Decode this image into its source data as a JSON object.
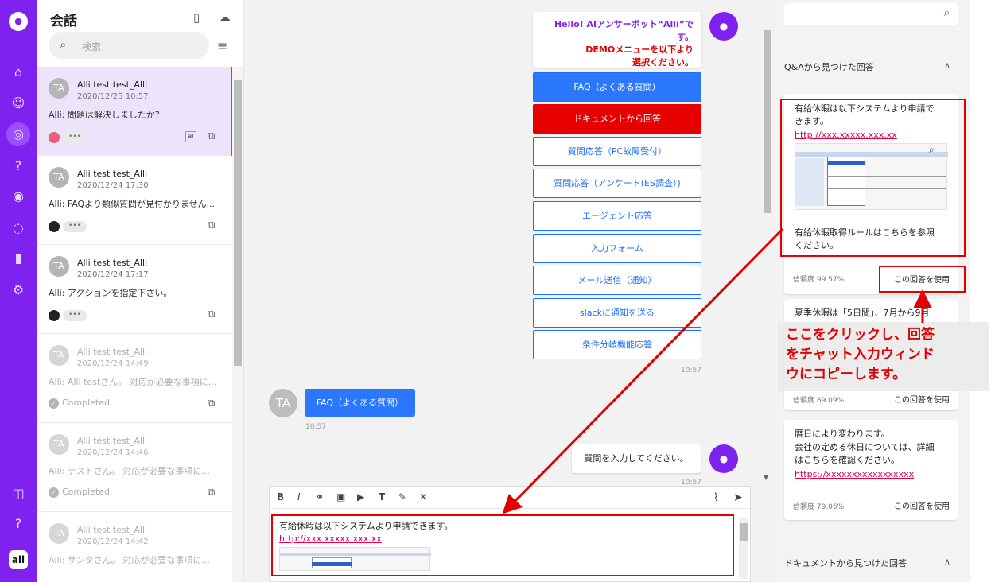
{
  "rail": {
    "logo": "●",
    "icons": [
      "home-icon",
      "user-icon",
      "chat-icon",
      "question-icon",
      "target-icon",
      "search-chat-icon",
      "bar-chart-icon",
      "gear-icon",
      "gift-icon",
      "help-icon"
    ],
    "badge": "all"
  },
  "conversations": {
    "title": "会話",
    "search_placeholder": "検索",
    "items": [
      {
        "initials": "TA",
        "name": "Alli test test_Alli",
        "date": "2020/12/25 10:57",
        "message": "Alli: 問題は解決しましたか？",
        "dots": "•••",
        "badge": "all"
      },
      {
        "initials": "TA",
        "name": "Alli test test_Alli",
        "date": "2020/12/24 17:30",
        "message": "Alli: FAQより類似質問が見付かりません...",
        "dots": "•••"
      },
      {
        "initials": "TA",
        "name": "Alli test test_Alli",
        "date": "2020/12/24 17:17",
        "message": "Alli: アクションを指定下さい。",
        "dots": "•••"
      },
      {
        "initials": "TA",
        "name": "Alli test test_Alli",
        "date": "2020/12/24 14:49",
        "message": "Alli: Alli testさん。 対応が必要な事項に...",
        "status": "Completed"
      },
      {
        "initials": "TA",
        "name": "Alli test test_Alli",
        "date": "2020/12/24 14:46",
        "message": "Alli: テストさん。 対応が必要な事項に...",
        "status": "Completed"
      },
      {
        "initials": "TA",
        "name": "Alli test test_Alli",
        "date": "2020/12/24 14:42",
        "message": "Alli: サンタさん。 対応が必要な事項に..."
      }
    ]
  },
  "chat": {
    "bot_initial": "●",
    "greeting_line1": "Hello! AIアンサーボット“Alli”です。",
    "greeting_line2": "DEMOメニューを以下より",
    "greeting_line3": "選択ください。",
    "menu": [
      "FAQ（よくある質問）",
      "ドキュメントから回答",
      "質問応答（PC故障受付）",
      "質問応答（アンケート(ES調査）)",
      "エージェント応答",
      "入力フォーム",
      "メール送信（通知）",
      "slackに通知を送る",
      "条件分岐機能応答"
    ],
    "menu_time": "10:57",
    "user_initials": "TA",
    "user_message": "FAQ（よくある質問）",
    "user_time": "10:57",
    "prompt": "質問を入力してください。",
    "prompt_time": "10:57"
  },
  "composer": {
    "toolbar": [
      "B",
      "I",
      "⚭",
      "▣",
      "▶",
      "T",
      "✎",
      "✕"
    ],
    "text": "有給休暇は以下システムより申請できます。",
    "link": "http://xxx.xxxxx.xxx.xx"
  },
  "right": {
    "qa_title": "Q&Aから見つけた回答",
    "card1_text1": "有給休暇は以下システムより申請で",
    "card1_text2": "きます。",
    "card1_link": "http://xxx.xxxxx.xxx.xx",
    "card1_text3": "有給休暇取得ルールはこちらを参照",
    "card1_text4": "ください。",
    "card1_conf": "信頼度 99.57%",
    "use_label": "この回答を使用",
    "card2_text": "夏季休暇は「5日間」、7月から9月",
    "card2_conf": "信頼度 89.09%",
    "card3_text1": "暦日により変わります。",
    "card3_text2": "会社の定める休日については、詳細",
    "card3_text3": "はこちらを確認ください。",
    "card3_link": "https://xxxxxxxxxxxxxxxxx",
    "card3_conf": "信頼度 79.06%",
    "doc_title": "ドキュメントから見つけた回答",
    "annotation_line1": "ここをクリックし、回答",
    "annotation_line2": "をチャット入力ウィンド",
    "annotation_line3": "ウにコピーします。"
  },
  "colors": {
    "accent": "#7f22f0",
    "blue": "#2b78ff",
    "red": "#e60000",
    "annotation": "#e00000"
  }
}
